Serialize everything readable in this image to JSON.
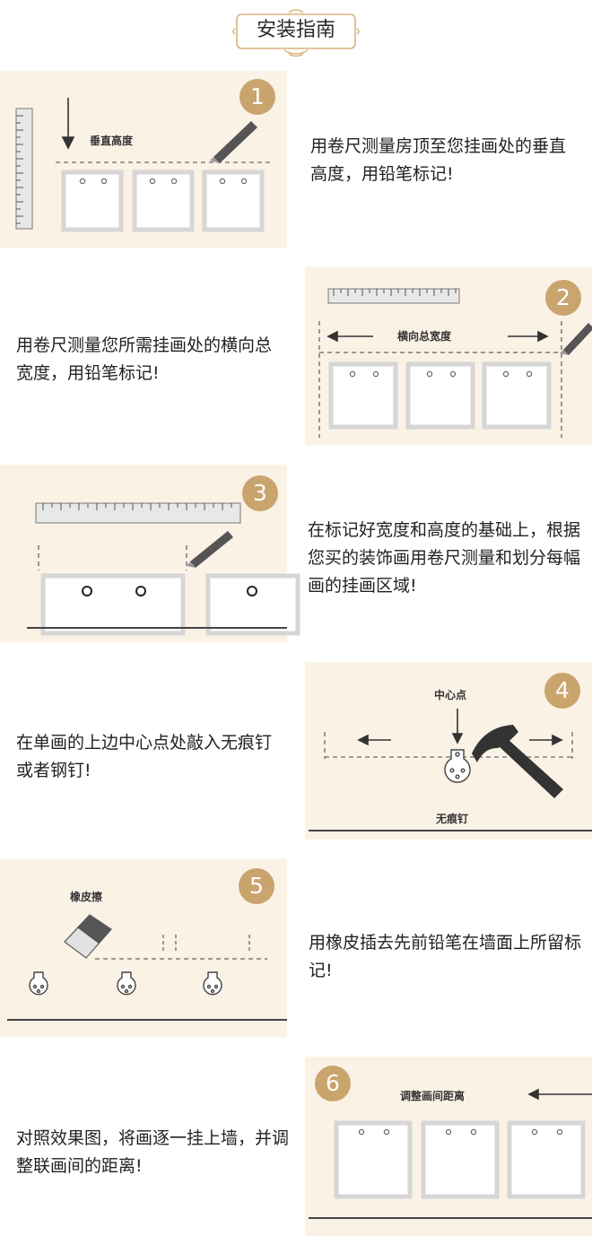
{
  "header": {
    "title": "安装指南"
  },
  "steps": [
    {
      "number": "1",
      "label": "垂直高度",
      "text": "用卷尺测量房顶至您挂画处的垂直高度，用铅笔标记!"
    },
    {
      "number": "2",
      "label": "横向总宽度",
      "text": "用卷尺测量您所需挂画处的横向总宽度，用铅笔标记!"
    },
    {
      "number": "3",
      "label": "",
      "text": "在标记好宽度和高度的基础上，根据您买的装饰画用卷尺测量和划分每幅画的挂画区域!"
    },
    {
      "number": "4",
      "label": "中心点",
      "label2": "无痕钉",
      "text": "在单画的上边中心点处敲入无痕钉或者钢钉!"
    },
    {
      "number": "5",
      "label": "橡皮擦",
      "text": "用橡皮插去先前铅笔在墙面上所留标记!"
    },
    {
      "number": "6",
      "label": "调整画间距离",
      "text": "对照效果图，将画逐一挂上墙，并调整联画间的距离!"
    }
  ],
  "colors": {
    "panel_bg": "#fbf2e6",
    "badge": "#c9a46d",
    "frame": "#d6d6d6",
    "ornament": "#d9b27a"
  }
}
